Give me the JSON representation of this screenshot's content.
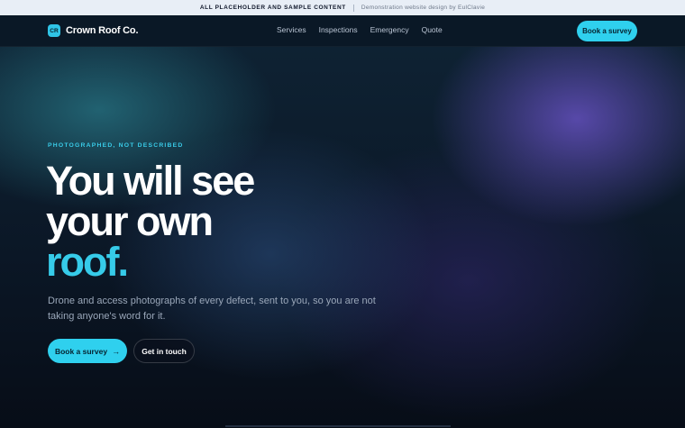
{
  "banner": {
    "strong_text": "ALL PLACEHOLDER AND SAMPLE CONTENT",
    "light_text": "Demonstration website design by EulClavie"
  },
  "header": {
    "brand_badge": "CR",
    "brand_name": "Crown Roof Co.",
    "nav": [
      "Services",
      "Inspections",
      "Emergency",
      "Quote"
    ],
    "cta_label": "Book a survey"
  },
  "hero": {
    "eyebrow": "PHOTOGRAPHED, NOT DESCRIBED",
    "headline_line1": "You will see",
    "headline_line2": "your own",
    "headline_accent": "roof.",
    "lede": "Drone and access photographs of every defect, sent to you, so you are not taking anyone's word for it.",
    "primary_cta": "Book a survey",
    "primary_cta_icon": "arrow-right-icon",
    "secondary_cta": "Get in touch"
  },
  "colors": {
    "accent": "#2fd0ee",
    "banner_bg": "#e8eef6",
    "header_bg": "#0a1826",
    "page_bg": "#0b1220"
  }
}
